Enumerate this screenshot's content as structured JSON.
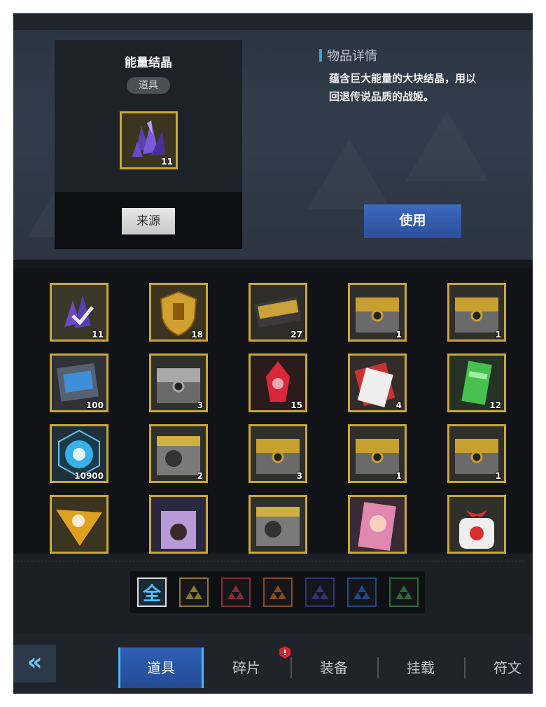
{
  "detail": {
    "item_name": "能量结晶",
    "item_type": "道具",
    "item_count": "11",
    "source_button": "来源",
    "section_title": "物品详情",
    "description_line1": "蕴含巨大能量的大块结晶，用以",
    "description_line2": "回退传说品质的战姬。",
    "use_button": "使用"
  },
  "inventory": {
    "items": [
      {
        "icon": "energy-crystal-icon",
        "count": "11",
        "selected": true
      },
      {
        "icon": "gold-shield-icon",
        "count": "18"
      },
      {
        "icon": "voucher-ticket-icon",
        "count": "27"
      },
      {
        "icon": "gold-chest-icon",
        "count": "1"
      },
      {
        "icon": "gold-chest-icon",
        "count": "1"
      },
      {
        "icon": "blue-chip-icon",
        "count": "100"
      },
      {
        "icon": "silver-chest-icon",
        "count": "3"
      },
      {
        "icon": "red-crystal-icon",
        "count": "15"
      },
      {
        "icon": "theory-book-icon",
        "count": "4"
      },
      {
        "icon": "green-ticket-icon",
        "count": "12"
      },
      {
        "icon": "blue-orb-icon",
        "count": "10900"
      },
      {
        "icon": "character-chest-icon",
        "count": "2"
      },
      {
        "icon": "gold-chest-icon",
        "count": "3"
      },
      {
        "icon": "gold-chest-icon",
        "count": "1"
      },
      {
        "icon": "gold-chest-icon",
        "count": "1"
      },
      {
        "icon": "gold-badge-icon",
        "count": ""
      },
      {
        "icon": "character-box-icon",
        "count": ""
      },
      {
        "icon": "character-chest-icon",
        "count": ""
      },
      {
        "icon": "pink-character-card-icon",
        "count": ""
      },
      {
        "icon": "red-gift-icon",
        "count": ""
      }
    ]
  },
  "filters": {
    "all_label": "全",
    "colors": [
      "#8a7a2a",
      "#8a2a36",
      "#8a4a1a",
      "#3a2e7a",
      "#1e4a8a",
      "#2a6a3a"
    ]
  },
  "nav": {
    "back_label": "«",
    "tabs": [
      "道具",
      "碎片",
      "装备",
      "挂载",
      "符文"
    ],
    "alert_label": "!"
  }
}
